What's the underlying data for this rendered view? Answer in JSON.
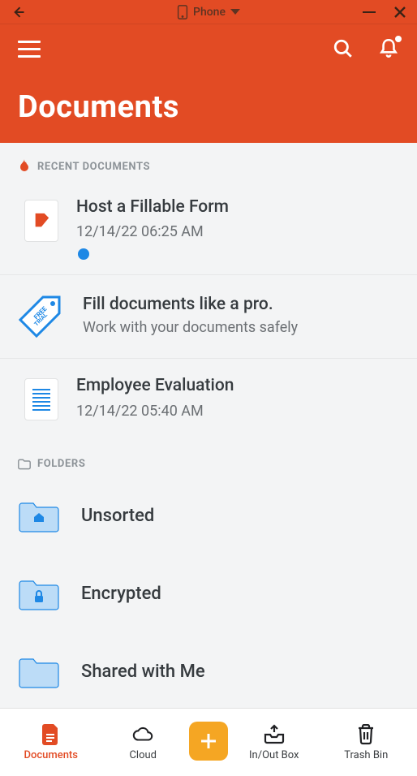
{
  "emulator": {
    "device_label": "Phone"
  },
  "header": {
    "title": "Documents"
  },
  "sections": {
    "recent_label": "RECENT DOCUMENTS",
    "folders_label": "FOLDERS"
  },
  "docs": [
    {
      "title": "Host a Fillable Form",
      "meta": "12/14/22 06:25 AM",
      "unread": true,
      "thumb": "pdf"
    },
    {
      "title": "Employee Evaluation",
      "meta": "12/14/22 05:40 AM",
      "unread": false,
      "thumb": "lines"
    }
  ],
  "promo": {
    "title": "Fill documents like a pro.",
    "subtitle": "Work with your documents safely"
  },
  "folders": [
    {
      "name": "Unsorted",
      "glyph": "home"
    },
    {
      "name": "Encrypted",
      "glyph": "lock"
    },
    {
      "name": "Shared with Me",
      "glyph": "share"
    }
  ],
  "nav": {
    "documents": "Documents",
    "cloud": "Cloud",
    "inout": "In/Out Box",
    "trash": "Trash Bin"
  }
}
